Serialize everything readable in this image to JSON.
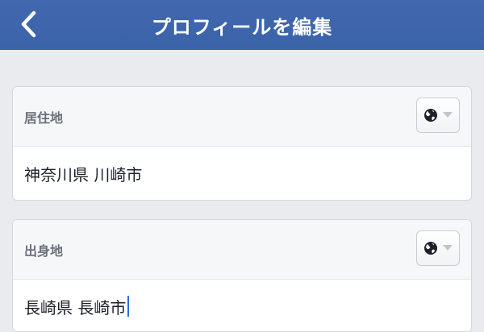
{
  "header": {
    "title": "プロフィールを編集",
    "back_icon": "chevron-left-icon",
    "bg_color": "#3b64aa"
  },
  "fields": [
    {
      "label": "居住地",
      "value": "神奈川県 川崎市",
      "privacy_icon": "globe-icon"
    },
    {
      "label": "出身地",
      "value": "長崎県 長崎市",
      "privacy_icon": "globe-icon",
      "focused": true
    }
  ],
  "colors": {
    "accent": "#3b64aa",
    "caret": "#2f6de0",
    "background": "#e9ebee"
  }
}
